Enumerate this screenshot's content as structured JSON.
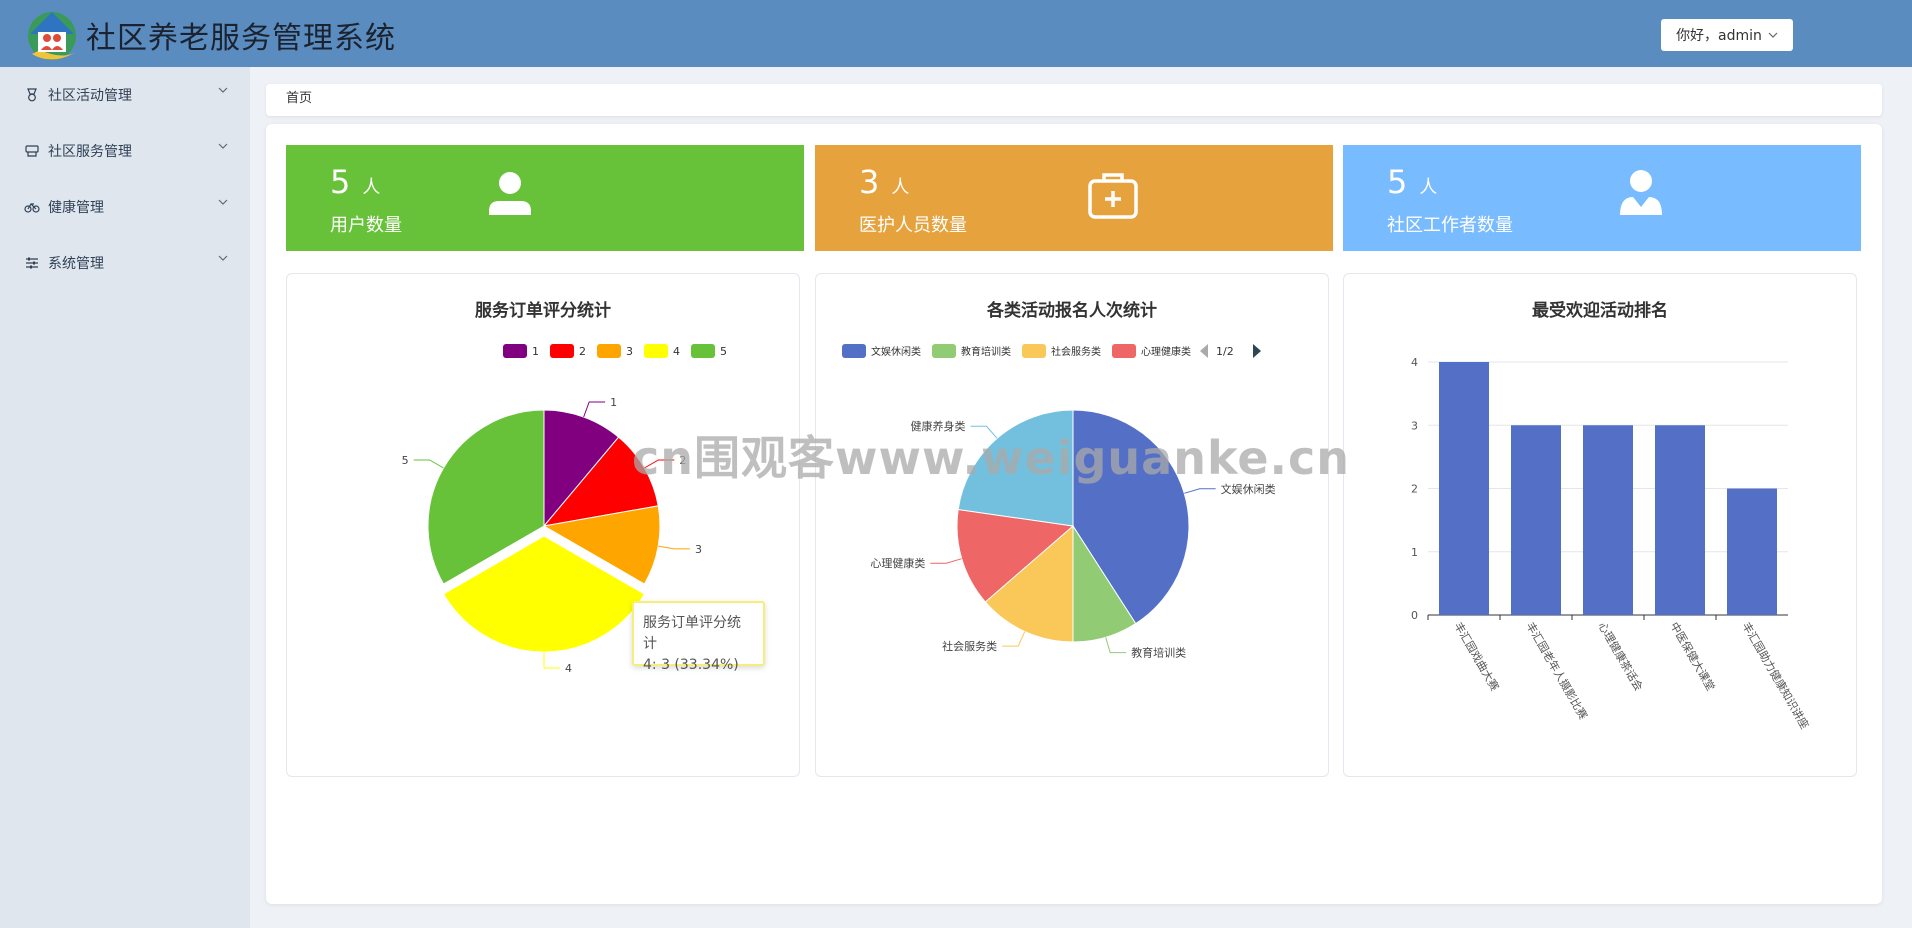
{
  "header": {
    "app_title": "社区养老服务管理系统",
    "user_greeting": "你好，admin"
  },
  "sidebar": {
    "items": [
      {
        "label": "社区活动管理",
        "icon": "medal-icon"
      },
      {
        "label": "社区服务管理",
        "icon": "service-icon"
      },
      {
        "label": "健康管理",
        "icon": "bicycle-icon"
      },
      {
        "label": "系统管理",
        "icon": "sliders-icon"
      }
    ]
  },
  "breadcrumb": {
    "home": "首页"
  },
  "stats": [
    {
      "value": "5",
      "unit": "人",
      "label": "用户数量",
      "color": "#67c23a",
      "icon": "user-icon"
    },
    {
      "value": "3",
      "unit": "人",
      "label": "医护人员数量",
      "color": "#e6a23c",
      "icon": "medical-kit-icon"
    },
    {
      "value": "5",
      "unit": "人",
      "label": "社区工作者数量",
      "color": "#79bbff",
      "icon": "worker-icon"
    }
  ],
  "chart_data": [
    {
      "type": "pie",
      "title": "服务订单评分统计",
      "categories": [
        "1",
        "2",
        "3",
        "4",
        "5"
      ],
      "values": [
        1,
        1,
        1,
        3,
        3
      ],
      "colors": [
        "#800080",
        "#ff0000",
        "#ffa500",
        "#ffff00",
        "#67c23a"
      ],
      "legend": "top",
      "tooltip": {
        "title": "服务订单评分统计",
        "text": "4: 3 (33.34%)"
      }
    },
    {
      "type": "pie",
      "title": "各类活动报名人次统计",
      "categories": [
        "文娱休闲类",
        "教育培训类",
        "社会服务类",
        "心理健康类",
        "健康养身类"
      ],
      "values": [
        9,
        2,
        3,
        3,
        5
      ],
      "colors": [
        "#5470c6",
        "#91cc75",
        "#fac858",
        "#ee6666",
        "#73c0de"
      ],
      "legend": "top",
      "legend_page": "1/2"
    },
    {
      "type": "bar",
      "title": "最受欢迎活动排名",
      "categories": [
        "丰汇园戏曲大赛",
        "丰汇园老年人摄影比赛",
        "心理健康茶话会",
        "中医保健大课堂",
        "丰汇园助力健康知识讲座"
      ],
      "values": [
        4,
        3,
        3,
        3,
        2
      ],
      "ylim": [
        0,
        4
      ],
      "yticks": [
        "0",
        "1",
        "2",
        "3",
        "4"
      ],
      "color": "#5470c6",
      "grid": true
    }
  ],
  "watermark": "cn围观客www.weiguanke.cn"
}
